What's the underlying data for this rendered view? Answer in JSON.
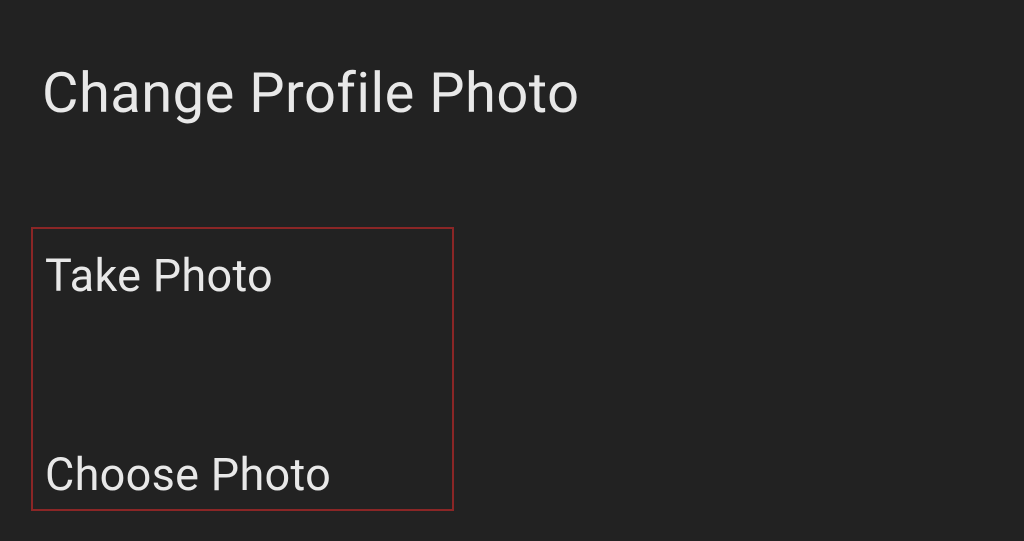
{
  "dialog": {
    "title": "Change Profile Photo",
    "options": {
      "take_photo": "Take Photo",
      "choose_photo": "Choose Photo"
    }
  }
}
